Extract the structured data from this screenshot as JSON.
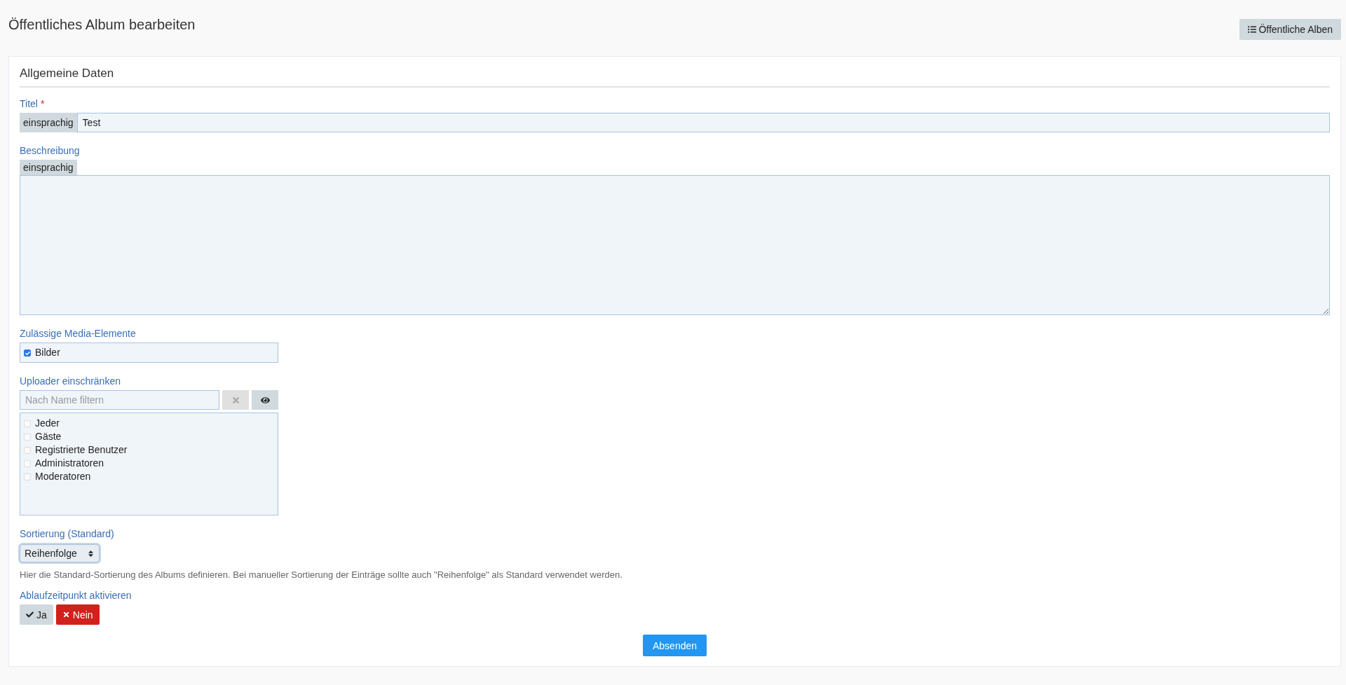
{
  "page": {
    "title": "Öffentliches Album bearbeiten",
    "list_button": "Öffentliche Alben"
  },
  "section": {
    "title": "Allgemeine Daten"
  },
  "title_field": {
    "label": "Titel",
    "required_mark": "*",
    "language": "einsprachig",
    "value": "Test"
  },
  "description_field": {
    "label": "Beschreibung",
    "language": "einsprachig"
  },
  "media_elements": {
    "label": "Zulässige Media-Elemente",
    "options": [
      {
        "label": "Bilder",
        "checked": true
      }
    ]
  },
  "uploader": {
    "label": "Uploader einschränken",
    "filter_placeholder": "Nach Name filtern",
    "groups": [
      {
        "label": "Jeder",
        "checked": false
      },
      {
        "label": "Gäste",
        "checked": false
      },
      {
        "label": "Registrierte Benutzer",
        "checked": false
      },
      {
        "label": "Administratoren",
        "checked": false
      },
      {
        "label": "Moderatoren",
        "checked": false
      }
    ]
  },
  "sorting": {
    "label": "Sortierung (Standard)",
    "value": "Reihenfolge",
    "help": "Hier die Standard-Sortierung des Albums definieren. Bei manueller Sortierung der Einträge sollte auch \"Reihenfolge\" als Standard verwendet werden."
  },
  "expiry": {
    "label": "Ablaufzeitpunkt aktivieren",
    "options": [
      {
        "kind": "yes",
        "label": "Ja",
        "selected": false
      },
      {
        "kind": "no",
        "label": "Nein",
        "selected": true
      }
    ]
  },
  "submit": "Absenden"
}
